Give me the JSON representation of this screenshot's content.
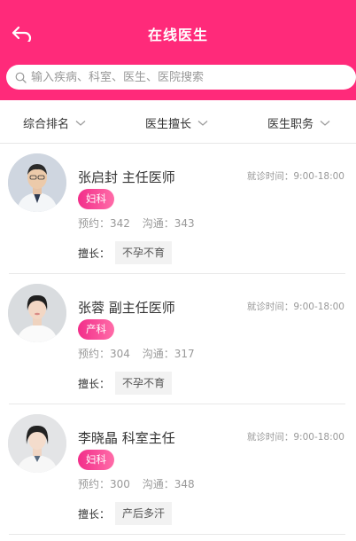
{
  "header": {
    "title": "在线医生",
    "back_icon": "back-arrow-icon",
    "background": "#FF2A7A"
  },
  "search": {
    "placeholder": "输入疾病、科室、医生、医院搜索",
    "icon": "search-icon"
  },
  "filters": [
    {
      "label": "综合排名"
    },
    {
      "label": "医生擅长"
    },
    {
      "label": "医生职务"
    }
  ],
  "doctors": [
    {
      "name_title": "张启封 主任医师",
      "hours": "就诊时间：9:00-18:00",
      "department": "妇科",
      "appointments": "预约：342",
      "consultations": "沟通：343",
      "specialty_label": "擅长：",
      "specialty": "不孕不育",
      "avatar": "male-doctor-photo"
    },
    {
      "name_title": "张蓉 副主任医师",
      "hours": "就诊时间：9:00-18:00",
      "department": "产科",
      "appointments": "预约：304",
      "consultations": "沟通：317",
      "specialty_label": "擅长：",
      "specialty": "不孕不育",
      "avatar": "female-doctor-photo"
    },
    {
      "name_title": "李晓晶 科室主任",
      "hours": "就诊时间：9:00-18:00",
      "department": "妇科",
      "appointments": "预约：300",
      "consultations": "沟通：348",
      "specialty_label": "擅长：",
      "specialty": "产后多汗",
      "avatar": "female-doctor-photo"
    }
  ],
  "colors": {
    "accent": "#FF2A7A",
    "badge_gradient_start": "#F22E8A",
    "badge_gradient_end": "#FF6CA8"
  }
}
